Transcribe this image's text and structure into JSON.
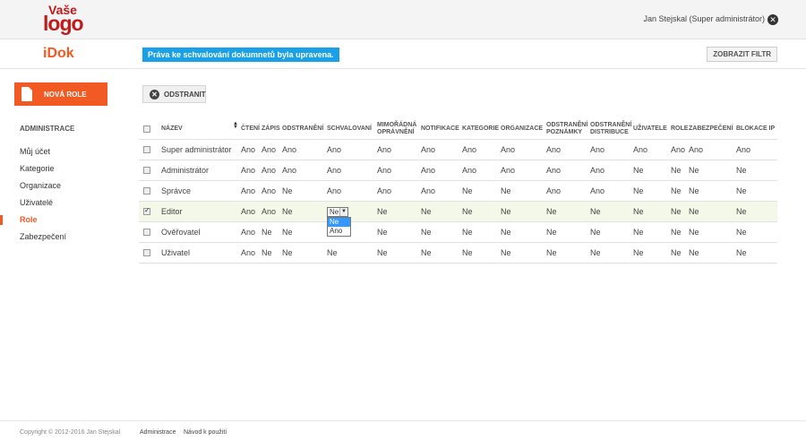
{
  "logo": {
    "line1": "Vaše",
    "line2": "logo"
  },
  "user": {
    "label": "Jan Stejskal (Super administrátor)"
  },
  "app": {
    "name": "iDok"
  },
  "flash": {
    "message": "Práva ke schvalování dokumnetů byla upravena."
  },
  "toolbar": {
    "filter_label": "ZOBRAZIT FILTR",
    "remove_label": "ODSTRANIT"
  },
  "sidebar": {
    "new_button": "NOVÁ ROLE",
    "heading": "ADMINISTRACE",
    "items": [
      {
        "label": "Můj účet"
      },
      {
        "label": "Kategorie"
      },
      {
        "label": "Organizace"
      },
      {
        "label": "Uživatelé"
      },
      {
        "label": "Role",
        "active": true
      },
      {
        "label": "Zabezpečení"
      }
    ]
  },
  "table": {
    "headers": [
      "NÁZEV",
      "ČTENÍ",
      "ZÁPIS",
      "ODSTRANĚNÍ",
      "SCHVALOVANÍ",
      "MIMOŘÁDNÁ OPRÁVNĚNÍ",
      "NOTIFIKACE",
      "KATEGORIE",
      "ORGANIZACE",
      "ODSTRANĚNÍ POZNÁMKY",
      "ODSTRANĚNÍ DISTRIBUCE",
      "UŽIVATELE",
      "ROLE",
      "ZABEZPEČENÍ",
      "BLOKACE IP"
    ],
    "rows": [
      {
        "checked": false,
        "cells": [
          "Super administrátor",
          "Ano",
          "Ano",
          "Ano",
          "Ano",
          "Ano",
          "Ano",
          "Ano",
          "Ano",
          "Ano",
          "Ano",
          "Ano",
          "Ano",
          "Ano",
          "Ano"
        ]
      },
      {
        "checked": false,
        "cells": [
          "Administrátor",
          "Ano",
          "Ano",
          "Ano",
          "Ano",
          "Ano",
          "Ano",
          "Ano",
          "Ano",
          "Ano",
          "Ano",
          "Ne",
          "Ne",
          "Ne",
          "Ne"
        ]
      },
      {
        "checked": false,
        "cells": [
          "Správce",
          "Ano",
          "Ano",
          "Ne",
          "Ano",
          "Ano",
          "Ano",
          "Ne",
          "Ne",
          "Ano",
          "Ano",
          "Ne",
          "Ne",
          "Ne",
          "Ne"
        ]
      },
      {
        "checked": true,
        "cells": [
          "Editor",
          "Ano",
          "Ano",
          "Ne",
          "",
          "Ne",
          "Ne",
          "Ne",
          "Ne",
          "Ne",
          "Ne",
          "Ne",
          "Ne",
          "Ne",
          "Ne"
        ]
      },
      {
        "checked": false,
        "cells": [
          "Ověřovatel",
          "Ano",
          "Ne",
          "Ne",
          "",
          "Ne",
          "Ne",
          "Ne",
          "Ne",
          "Ne",
          "Ne",
          "Ne",
          "Ne",
          "Ne",
          "Ne"
        ]
      },
      {
        "checked": false,
        "cells": [
          "Uživatel",
          "Ano",
          "Ne",
          "Ne",
          "Ne",
          "Ne",
          "Ne",
          "Ne",
          "Ne",
          "Ne",
          "Ne",
          "Ne",
          "Ne",
          "Ne",
          "Ne"
        ]
      }
    ],
    "dropdown": {
      "value": "Ne",
      "options": [
        "Ne",
        "Ano"
      ],
      "highlighted": "Ne"
    }
  },
  "footer": {
    "copyright": "Copyright © 2012-2016 Jan Stejskal",
    "links": [
      "Administrace",
      "Návod k použití"
    ]
  },
  "colors": {
    "accent": "#f15a22",
    "flash": "#1aa0e6",
    "selected_row": "#f3f8e8"
  },
  "icons": {
    "logout": "close-circle-icon",
    "remove": "close-circle-icon",
    "new_role": "document-icon",
    "sort": "sort-icon"
  }
}
